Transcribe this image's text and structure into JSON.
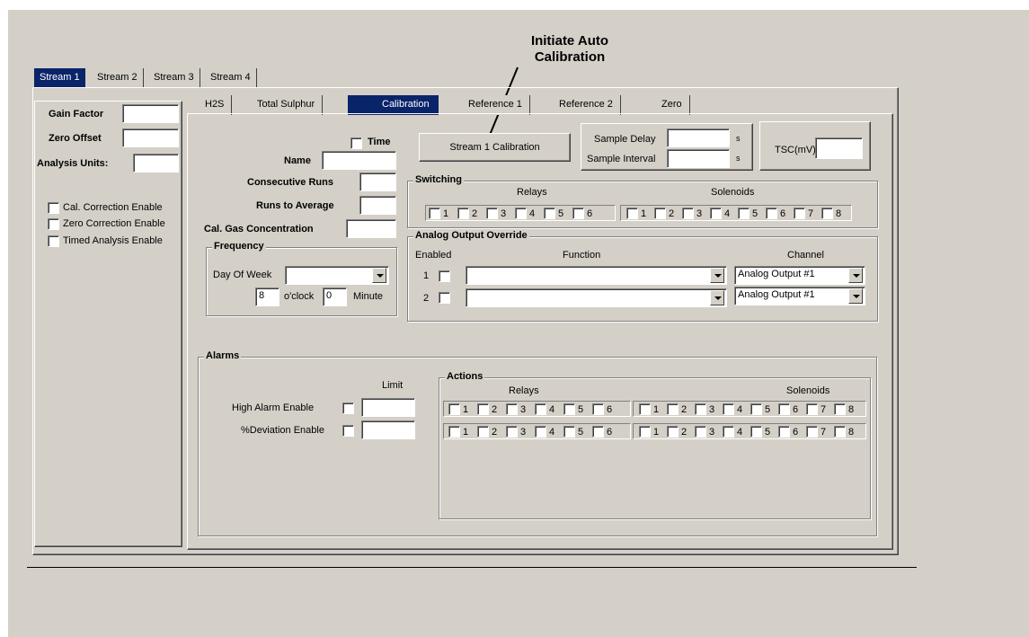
{
  "annotation": {
    "text": "Initiate Auto Calibration"
  },
  "stream_tabs": [
    "Stream 1",
    "Stream 2",
    "Stream 3",
    "Stream 4"
  ],
  "left_panel": {
    "gain_factor_label": "Gain Factor",
    "zero_offset_label": "Zero Offset",
    "analysis_units_label": "Analysis Units:",
    "cal_correction_label": "Cal. Correction Enable",
    "zero_correction_label": "Zero Correction Enable",
    "timed_analysis_label": "Timed Analysis Enable"
  },
  "inner_tabs": [
    "H2S",
    "Total Sulphur",
    "Calibration",
    "Reference 1",
    "Reference 2",
    "Zero"
  ],
  "calibration": {
    "time_label": "Time",
    "name_label": "Name",
    "consecutive_runs_label": "Consecutive Runs",
    "runs_to_average_label": "Runs to Average",
    "cal_gas_label": "Cal. Gas Concentration",
    "stream_button": "Stream 1 Calibration",
    "sample_delay_label": "Sample Delay",
    "sample_interval_label": "Sample Interval",
    "seconds_unit": "s",
    "tsc_label": "TSC(mV)"
  },
  "frequency": {
    "title": "Frequency",
    "day_of_week_label": "Day Of Week",
    "hour_value": "8",
    "oclock_label": "o'clock",
    "minute_value": "0",
    "minute_label": "Minute"
  },
  "switching": {
    "title": "Switching",
    "relays_label": "Relays",
    "solenoids_label": "Solenoids",
    "relays": [
      "1",
      "2",
      "3",
      "4",
      "5",
      "6"
    ],
    "solenoids": [
      "1",
      "2",
      "3",
      "4",
      "5",
      "6",
      "7",
      "8"
    ]
  },
  "analog_output": {
    "title": "Analog Output Override",
    "enabled_label": "Enabled",
    "function_label": "Function",
    "channel_label": "Channel",
    "rows": [
      {
        "num": "1",
        "channel": "Analog Output #1"
      },
      {
        "num": "2",
        "channel": "Analog Output #1"
      }
    ]
  },
  "alarms": {
    "title": "Alarms",
    "limit_label": "Limit",
    "high_alarm_label": "High Alarm Enable",
    "deviation_label": "%Deviation Enable"
  },
  "actions": {
    "title": "Actions",
    "relays_label": "Relays",
    "solenoids_label": "Solenoids"
  }
}
